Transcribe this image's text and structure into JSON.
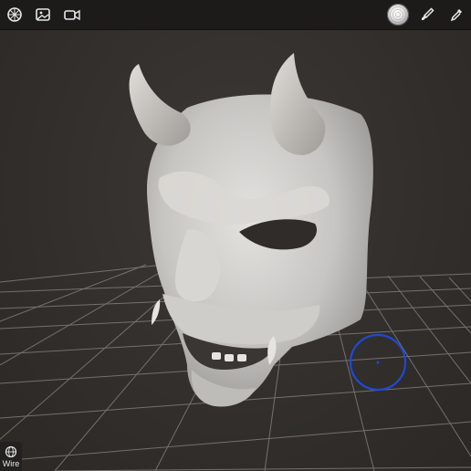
{
  "toolbar": {
    "left_icons": [
      "scene-icon",
      "image-icon",
      "video-icon"
    ],
    "right_icons": [
      "brush-preview",
      "brush-icon",
      "dropper-icon"
    ]
  },
  "wire_button": {
    "label": "Wire",
    "icon": "sphere-wire-icon"
  },
  "colors": {
    "background": "#33302d",
    "toolbar": "#1c1b1a",
    "grid": "#8b8783",
    "model": "#d3d1ce",
    "cursor": "#1f49d6"
  }
}
